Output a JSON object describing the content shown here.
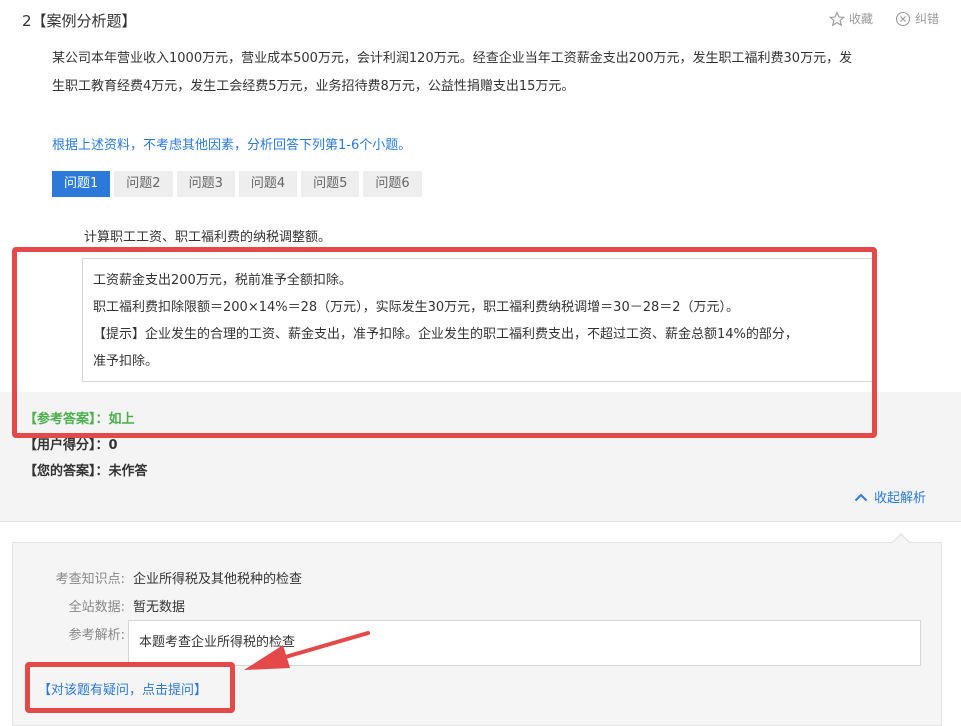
{
  "question": {
    "header": "2【案例分析题】",
    "stem_line1": "某公司本年营业收入1000万元，营业成本500万元，会计利润120万元。经查企业当年工资薪金支出200万元，发生职工福利费30万元，发",
    "stem_line2": "生职工教育经费4万元，发生工会经费5万元，业务招待费8万元，公益性捐赠支出15万元。",
    "instruction": "根据上述资料，不考虑其他因素，分析回答下列第1-6个小题。"
  },
  "actions": {
    "favorite": "收藏",
    "report": "纠错"
  },
  "tabs": [
    "问题1",
    "问题2",
    "问题3",
    "问题4",
    "问题5",
    "问题6"
  ],
  "subquestion": "计算职工工资、职工福利费的纳税调整额。",
  "answer_lines": [
    "工资薪金支出200万元，税前准予全额扣除。",
    "职工福利费扣除限额＝200×14%＝28（万元），实际发生30万元，职工福利费纳税调增＝30－28＝2（万元）。",
    "【提示】企业发生的合理的工资、薪金支出，准予扣除。企业发生的职工福利费支出，不超过工资、薪金总额14%的部分，",
    "准予扣除。"
  ],
  "result": {
    "ref_label": "【参考答案】：",
    "ref_value": "如上",
    "score_label": "【用户得分】：",
    "score_value": "0",
    "yours_label": "【您的答案】：",
    "yours_value": "未作答",
    "collapse_label": "收起解析"
  },
  "analysis": {
    "knowledge_label": "考查知识点:",
    "knowledge_value": "企业所得税及其他税种的检查",
    "stats_label": "全站数据:",
    "stats_value": "暂无数据",
    "explain_label": "参考解析:",
    "explain_value": "本题考查企业所得税的检查",
    "ask_link": "【对该题有疑问，点击提问】"
  },
  "colors": {
    "accent": "#2b7ad9",
    "correct": "#4cae4c",
    "highlight": "#e54848"
  }
}
